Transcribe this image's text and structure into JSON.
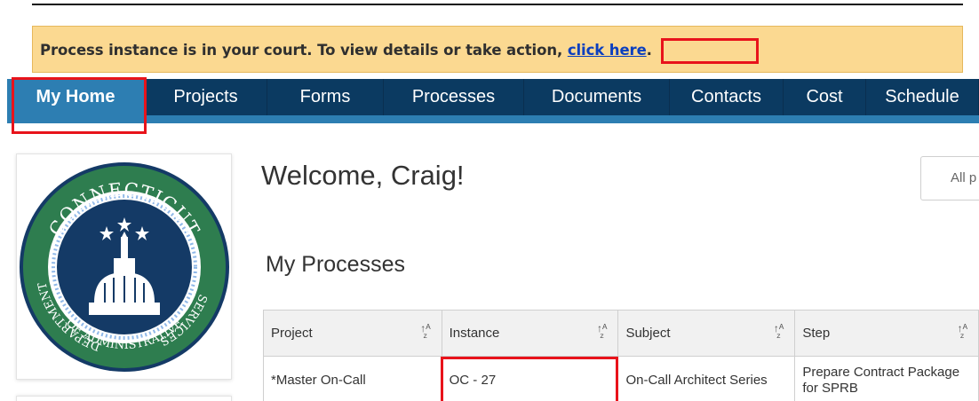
{
  "banner": {
    "message": "Process instance is in your court. To view details or take action, ",
    "link": "click here",
    "trailing": "."
  },
  "nav": {
    "items": [
      {
        "label": "My Home",
        "active": true
      },
      {
        "label": "Projects"
      },
      {
        "label": "Forms"
      },
      {
        "label": "Processes"
      },
      {
        "label": "Documents"
      },
      {
        "label": "Contacts"
      },
      {
        "label": "Cost"
      },
      {
        "label": "Schedule"
      }
    ]
  },
  "logo": {
    "top_text": "CONNECTICUT",
    "left_text": "DEPARTMENT",
    "bottom_text": "OF ADMINISTRATIVE",
    "right_text": "SERVICES"
  },
  "welcome": "Welcome, Craig!",
  "filter": {
    "placeholder": "All p"
  },
  "section_title": "My Processes",
  "table": {
    "columns": [
      "Project",
      "Instance",
      "Subject",
      "Step"
    ],
    "rows": [
      {
        "project": "*Master On-Call",
        "instance": "OC - 27",
        "subject": "On-Call Architect Series",
        "step": "Prepare Contract Package for SPRB"
      }
    ]
  },
  "colors": {
    "nav_bg": "#0b3a61",
    "nav_active": "#2d7eb2",
    "banner_bg": "#fbd991",
    "highlight": "#e8131b",
    "link": "#1f6ea8",
    "seal_green": "#2e7d4f",
    "seal_navy": "#143a66"
  }
}
